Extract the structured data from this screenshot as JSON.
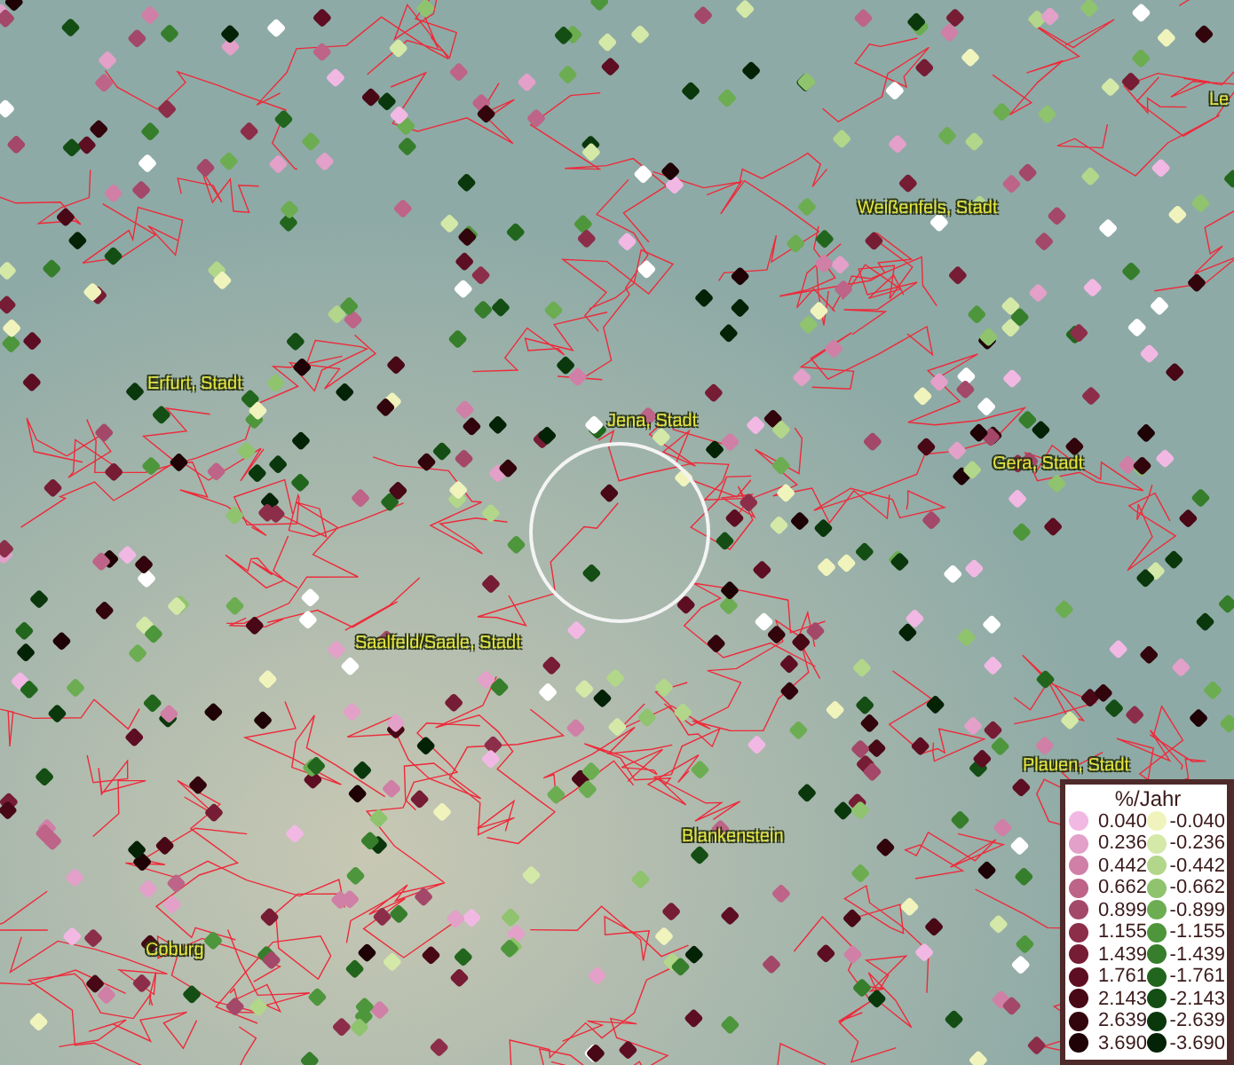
{
  "map": {
    "places": [
      {
        "name": "Le"
      },
      {
        "name": "Weißenfels, Stadt"
      },
      {
        "name": "Erfurt, Stadt"
      },
      {
        "name": "Jena, Stadt"
      },
      {
        "name": "Gera, Stadt"
      },
      {
        "name": "Saalfeld/Saale, Stadt"
      },
      {
        "name": "Plauen, Stadt"
      },
      {
        "name": "Blankenstein"
      },
      {
        "name": "Coburg"
      }
    ]
  },
  "legend": {
    "title": "%/Jahr",
    "positive": [
      {
        "label": "0.040",
        "color": "#f2b8e4"
      },
      {
        "label": "0.236",
        "color": "#e3a0c8"
      },
      {
        "label": "0.442",
        "color": "#d07fa6"
      },
      {
        "label": "0.662",
        "color": "#bd6488"
      },
      {
        "label": "0.899",
        "color": "#a34868"
      },
      {
        "label": "1.155",
        "color": "#8c2e4a"
      },
      {
        "label": "1.439",
        "color": "#761c34"
      },
      {
        "label": "1.761",
        "color": "#5e0e22"
      },
      {
        "label": "2.143",
        "color": "#480816"
      },
      {
        "label": "2.639",
        "color": "#32040c"
      },
      {
        "label": "3.690",
        "color": "#1e0206"
      }
    ],
    "negative": [
      {
        "label": "-0.040",
        "color": "#f0f4bc"
      },
      {
        "label": "-0.236",
        "color": "#d4e8a8"
      },
      {
        "label": "-0.442",
        "color": "#b2d68a"
      },
      {
        "label": "-0.662",
        "color": "#8fc36e"
      },
      {
        "label": "-0.899",
        "color": "#6cad52"
      },
      {
        "label": "-1.155",
        "color": "#4e963c"
      },
      {
        "label": "-1.439",
        "color": "#367e2c"
      },
      {
        "label": "-1.761",
        "color": "#22661e"
      },
      {
        "label": "-2.143",
        "color": "#144e14"
      },
      {
        "label": "-2.639",
        "color": "#0a380c"
      },
      {
        "label": "-3.690",
        "color": "#042206"
      }
    ]
  }
}
